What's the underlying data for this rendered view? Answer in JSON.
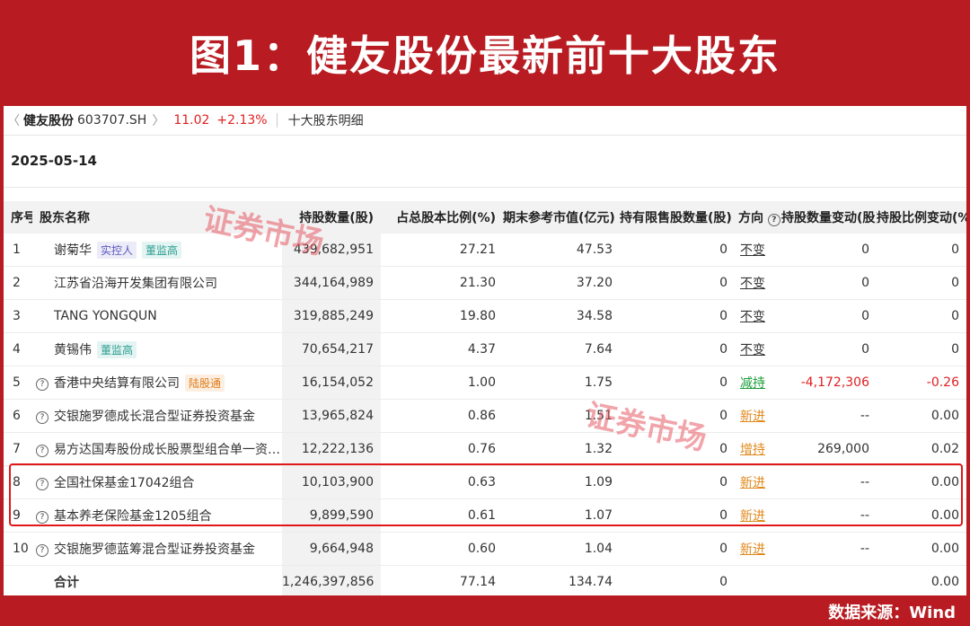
{
  "banner": {
    "title": "图1：健友股份最新前十大股东"
  },
  "crumb": {
    "back": "〈",
    "stock_name": "健友股份",
    "stock_code": "603707.SH",
    "arrow": "〉",
    "price": "11.02",
    "change": "+2.13%",
    "page": "十大股东明细"
  },
  "date": "2025-05-14",
  "watermark": "证券市场",
  "table": {
    "headers": [
      "序号",
      "股东名称",
      "持股数量(股)",
      "占总股本比例(%)",
      "期末参考市值(亿元)",
      "持有限售股数量(股)",
      "方向",
      "持股数量变动(股)",
      "持股比例变动(%)"
    ],
    "rows": [
      {
        "idx": "1",
        "q": "",
        "name": "谢菊华",
        "tags": [
          "实控人",
          "董监高"
        ],
        "shares": "439,682,951",
        "ratio": "27.21",
        "mv": "47.53",
        "restricted": "0",
        "dir": "不变",
        "chg_shares": "0",
        "chg_ratio": "0"
      },
      {
        "idx": "2",
        "q": "",
        "name": "江苏省沿海开发集团有限公司",
        "tags": [],
        "shares": "344,164,989",
        "ratio": "21.30",
        "mv": "37.20",
        "restricted": "0",
        "dir": "不变",
        "chg_shares": "0",
        "chg_ratio": "0"
      },
      {
        "idx": "3",
        "q": "",
        "name": "TANG YONGQUN",
        "tags": [],
        "shares": "319,885,249",
        "ratio": "19.80",
        "mv": "34.58",
        "restricted": "0",
        "dir": "不变",
        "chg_shares": "0",
        "chg_ratio": "0"
      },
      {
        "idx": "4",
        "q": "",
        "name": "黄锡伟",
        "tags": [
          "董监高"
        ],
        "shares": "70,654,217",
        "ratio": "4.37",
        "mv": "7.64",
        "restricted": "0",
        "dir": "不变",
        "chg_shares": "0",
        "chg_ratio": "0"
      },
      {
        "idx": "5",
        "q": "?",
        "name": "香港中央结算有限公司",
        "tags": [
          "陆股通"
        ],
        "shares": "16,154,052",
        "ratio": "1.00",
        "mv": "1.75",
        "restricted": "0",
        "dir": "减持",
        "chg_shares": "-4,172,306",
        "chg_ratio": "-0.26"
      },
      {
        "idx": "6",
        "q": "?",
        "name": "交银施罗德成长混合型证券投资基金",
        "tags": [],
        "shares": "13,965,824",
        "ratio": "0.86",
        "mv": "1.51",
        "restricted": "0",
        "dir": "新进",
        "chg_shares": "--",
        "chg_ratio": "0.00"
      },
      {
        "idx": "7",
        "q": "?",
        "name": "易方达国寿股份成长股票型组合单一资产管...",
        "tags": [],
        "shares": "12,222,136",
        "ratio": "0.76",
        "mv": "1.32",
        "restricted": "0",
        "dir": "增持",
        "chg_shares": "269,000",
        "chg_ratio": "0.02"
      },
      {
        "idx": "8",
        "q": "?",
        "name": "全国社保基金17042组合",
        "tags": [],
        "shares": "10,103,900",
        "ratio": "0.63",
        "mv": "1.09",
        "restricted": "0",
        "dir": "新进",
        "chg_shares": "--",
        "chg_ratio": "0.00"
      },
      {
        "idx": "9",
        "q": "?",
        "name": "基本养老保险基金1205组合",
        "tags": [],
        "shares": "9,899,590",
        "ratio": "0.61",
        "mv": "1.07",
        "restricted": "0",
        "dir": "新进",
        "chg_shares": "--",
        "chg_ratio": "0.00"
      },
      {
        "idx": "10",
        "q": "?",
        "name": "交银施罗德蓝筹混合型证券投资基金",
        "tags": [],
        "shares": "9,664,948",
        "ratio": "0.60",
        "mv": "1.04",
        "restricted": "0",
        "dir": "新进",
        "chg_shares": "--",
        "chg_ratio": "0.00"
      }
    ],
    "total": {
      "label": "合计",
      "shares": "1,246,397,856",
      "ratio": "77.14",
      "mv": "134.74",
      "restricted": "0",
      "chg_ratio": "0.00"
    }
  },
  "footer": "数据来源：Wind",
  "colors": {
    "background": "#b81c22",
    "up": "#e02020",
    "down": "#1a9e3a",
    "new": "#e08a1e",
    "highlight": "#e01818"
  }
}
